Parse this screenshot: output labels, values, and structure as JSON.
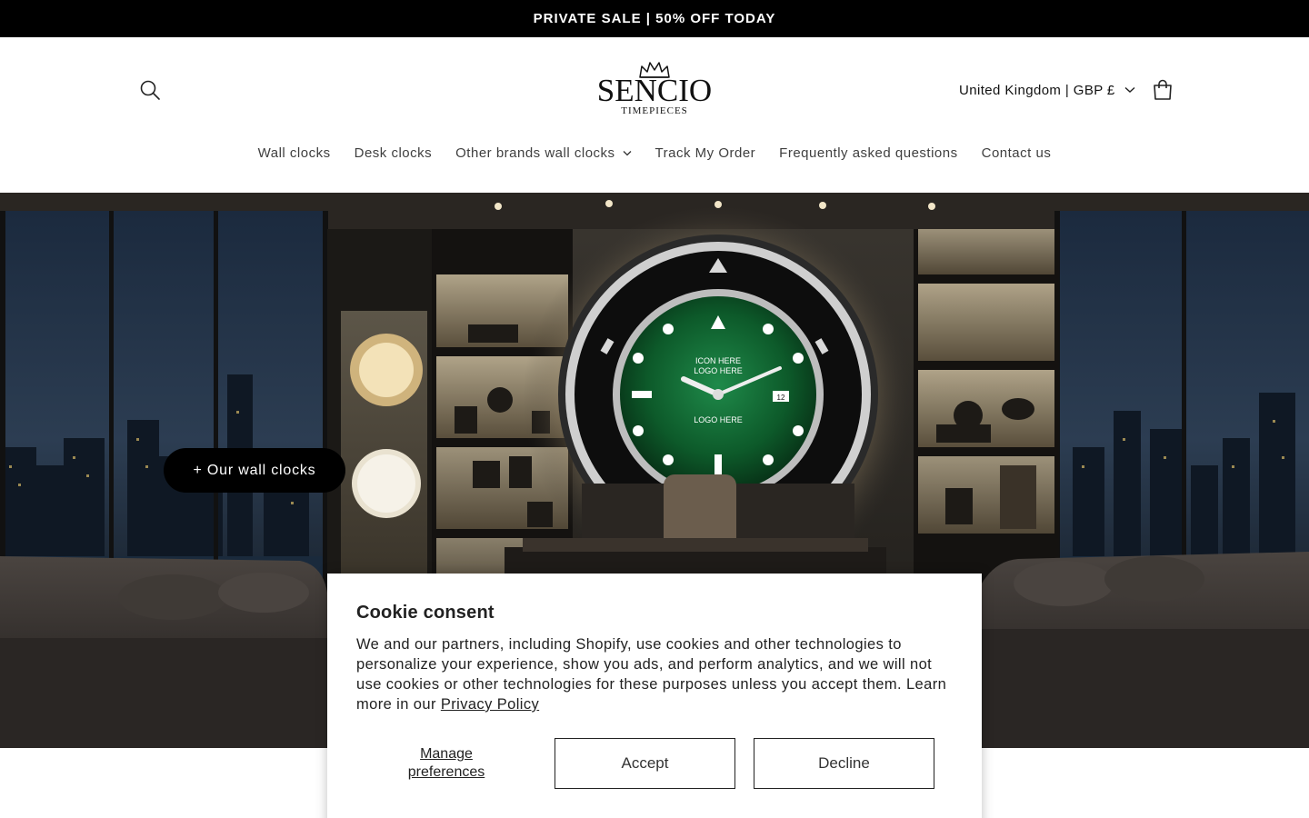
{
  "announcement": {
    "text": "PRIVATE SALE | 50% OFF TODAY"
  },
  "header": {
    "logo": {
      "name": "SENCIO",
      "sub": "TIMEPIECES"
    },
    "locale": "United Kingdom | GBP £",
    "icons": {
      "search": "search-icon",
      "cart": "cart-icon",
      "locale_chevron": "chevron-down-icon"
    }
  },
  "nav": {
    "items": [
      {
        "label": "Wall clocks"
      },
      {
        "label": "Desk clocks"
      },
      {
        "label": "Other brands wall clocks",
        "has_dropdown": true
      },
      {
        "label": "Track My Order"
      },
      {
        "label": "Frequently asked questions"
      },
      {
        "label": "Contact us"
      }
    ]
  },
  "hero": {
    "cta": "+ Our wall clocks",
    "watch_text": {
      "line1": "ICON HERE",
      "line2": "LOGO HERE",
      "line3": "LOGO HERE",
      "date": "12"
    }
  },
  "cookie": {
    "title": "Cookie consent",
    "body": "We and our partners, including Shopify, use cookies and other technologies to personalize your experience, show you ads, and perform analytics, and we will not use cookies or other technologies for these purposes unless you accept them. Learn more in our ",
    "link": "Privacy Policy",
    "manage_line1": "Manage",
    "manage_line2": "preferences",
    "accept": "Accept",
    "decline": "Decline"
  },
  "colors": {
    "announcement_bg": "#000000",
    "cta_bg": "#000000",
    "dial_green": "#0d5a2a"
  }
}
